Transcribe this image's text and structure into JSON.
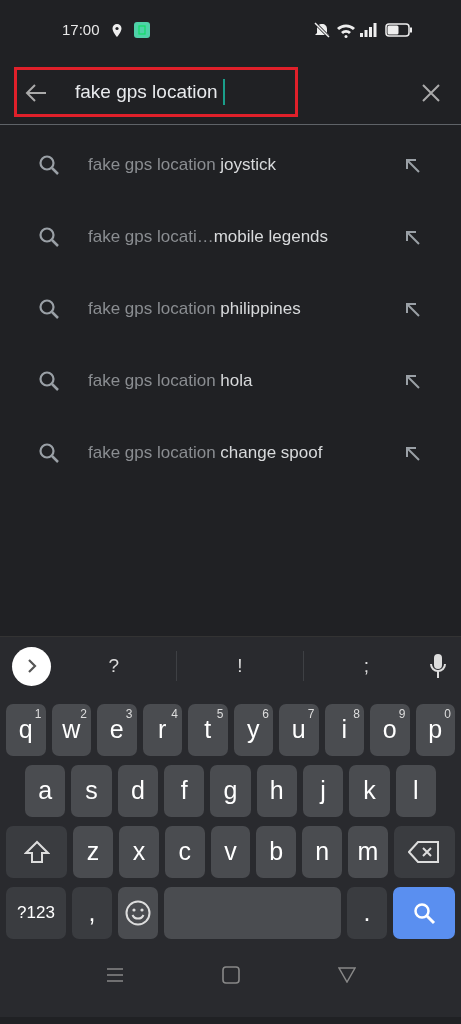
{
  "status_bar": {
    "time": "17:00"
  },
  "search": {
    "value": "fake gps location",
    "highlighted": true
  },
  "suggestions": [
    {
      "query": "fake gps location",
      "completion": "joystick"
    },
    {
      "query": "fake gps locati…",
      "completion": "mobile legends"
    },
    {
      "query": "fake gps location",
      "completion": "philippines"
    },
    {
      "query": "fake gps location",
      "completion": "hola"
    },
    {
      "query": "fake gps location",
      "completion": "change spoof"
    }
  ],
  "keyboard": {
    "suggestion_strip": [
      "?",
      "!",
      ";"
    ],
    "rows": [
      {
        "keys": [
          {
            "kind": "letter",
            "label": "q",
            "hint": "1"
          },
          {
            "kind": "letter",
            "label": "w",
            "hint": "2"
          },
          {
            "kind": "letter",
            "label": "e",
            "hint": "3"
          },
          {
            "kind": "letter",
            "label": "r",
            "hint": "4"
          },
          {
            "kind": "letter",
            "label": "t",
            "hint": "5"
          },
          {
            "kind": "letter",
            "label": "y",
            "hint": "6"
          },
          {
            "kind": "letter",
            "label": "u",
            "hint": "7"
          },
          {
            "kind": "letter",
            "label": "i",
            "hint": "8"
          },
          {
            "kind": "letter",
            "label": "o",
            "hint": "9"
          },
          {
            "kind": "letter",
            "label": "p",
            "hint": "0"
          }
        ]
      },
      {
        "keys": [
          {
            "kind": "letter",
            "label": "a"
          },
          {
            "kind": "letter",
            "label": "s"
          },
          {
            "kind": "letter",
            "label": "d"
          },
          {
            "kind": "letter",
            "label": "f"
          },
          {
            "kind": "letter",
            "label": "g"
          },
          {
            "kind": "letter",
            "label": "h"
          },
          {
            "kind": "letter",
            "label": "j"
          },
          {
            "kind": "letter",
            "label": "k"
          },
          {
            "kind": "letter",
            "label": "l"
          }
        ]
      },
      {
        "keys": [
          {
            "kind": "shift"
          },
          {
            "kind": "letter",
            "label": "z"
          },
          {
            "kind": "letter",
            "label": "x"
          },
          {
            "kind": "letter",
            "label": "c"
          },
          {
            "kind": "letter",
            "label": "v"
          },
          {
            "kind": "letter",
            "label": "b"
          },
          {
            "kind": "letter",
            "label": "n"
          },
          {
            "kind": "letter",
            "label": "m"
          },
          {
            "kind": "backspace"
          }
        ]
      },
      {
        "keys": [
          {
            "kind": "symbols",
            "label": "?123"
          },
          {
            "kind": "punct",
            "label": ","
          },
          {
            "kind": "emoji"
          },
          {
            "kind": "space"
          },
          {
            "kind": "punct",
            "label": "."
          },
          {
            "kind": "search"
          }
        ]
      }
    ]
  }
}
